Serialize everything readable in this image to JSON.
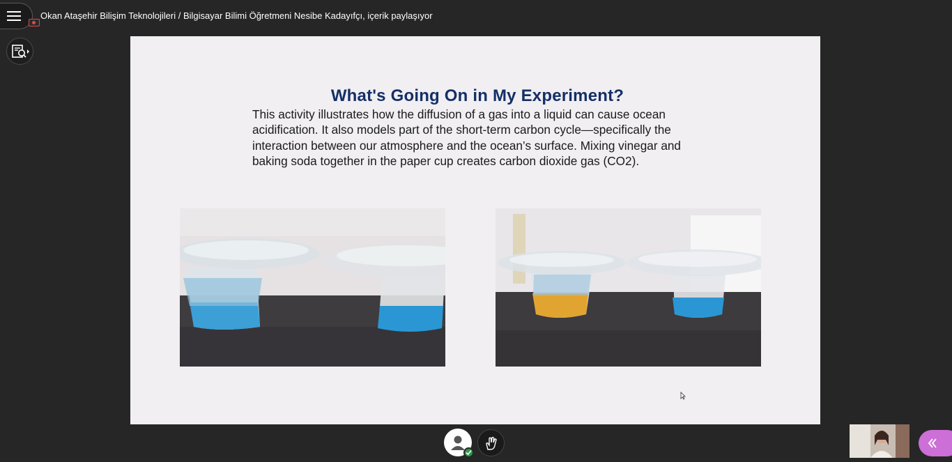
{
  "header": {
    "session_title": "Okan Ataşehir Bilişim Teknolojileri / Bilgisayar Bilimi Öğretmeni Nesibe Kadayıfçı, içerik paylaşıyor",
    "menu_icon": "hamburger-icon",
    "recording_icon": "recording-icon"
  },
  "sidebar": {
    "collab_icon": "search-content-icon"
  },
  "slide": {
    "title": "What's Going On in My Experiment?",
    "body_lines": [
      "This activity illustrates how the diffusion of a gas into a liquid can cause ocean",
      "acidification. It also models part of the short-term carbon cycle—specifically the",
      "interaction between our atmosphere and the ocean’s surface. Mixing vinegar and",
      "baking soda together in the paper cup creates carbon dioxide gas (CO2)."
    ],
    "photos": [
      {
        "description_icon": "experiment-photo-blue-cups",
        "liquid_colors": [
          "#3c9fd6",
          "#2a97d4"
        ]
      },
      {
        "description_icon": "experiment-photo-yellow-blue-cups",
        "liquid_colors": [
          "#e2a431",
          "#2a97d4"
        ]
      }
    ]
  },
  "footer": {
    "avatar_icon": "user-avatar-icon",
    "status_icon": "available-check-icon",
    "hand_icon": "raise-hand-icon",
    "panel_toggle_icon": "double-chevron-left-icon"
  },
  "colors": {
    "background": "#262626",
    "slide_bg": "#f1eff2",
    "title_blue": "#152f66",
    "accent_purple": "#cc6fd6",
    "status_green": "#2a9a4a"
  }
}
